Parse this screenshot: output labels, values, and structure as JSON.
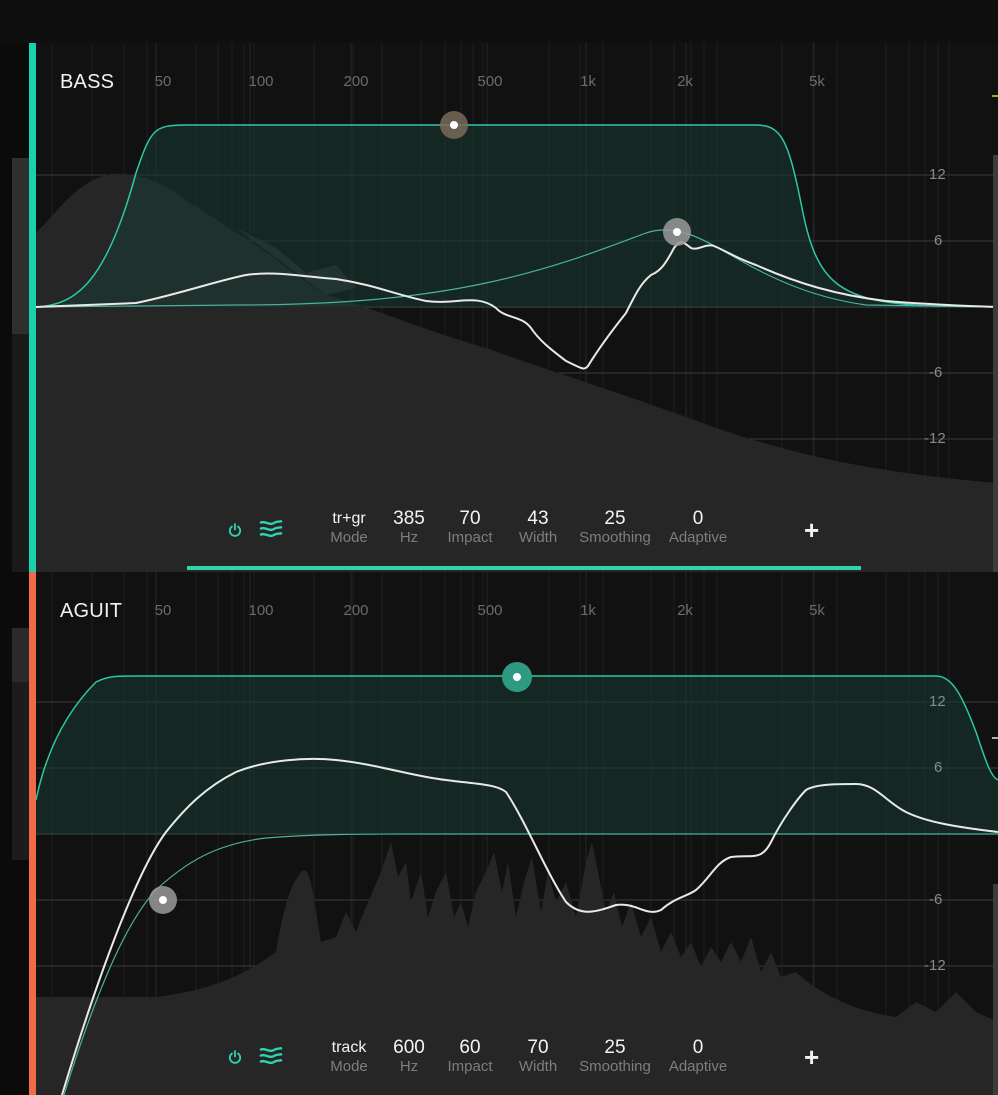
{
  "colors": {
    "accent_bass": "#19d2ad",
    "accent_aguit": "#f06a45",
    "curve": "#e9e9e9",
    "band": "#2ec7a6"
  },
  "freq_axis": [
    "50",
    "100",
    "200",
    "500",
    "1k",
    "2k",
    "5k"
  ],
  "db_axis": [
    "12",
    "6",
    "-6",
    "-12"
  ],
  "tracks": [
    {
      "name": "BASS",
      "mode": "tr+gr",
      "mode_label": "Mode",
      "hz": "385",
      "hz_label": "Hz",
      "impact": "70",
      "impact_label": "Impact",
      "width": "43",
      "width_label": "Width",
      "smoothing": "25",
      "smoothing_label": "Smoothing",
      "adaptive": "0",
      "adaptive_label": "Adaptive",
      "power_icon": "power-icon",
      "waves_icon": "waves-icon",
      "add_label": "+"
    },
    {
      "name": "AGUIT",
      "mode": "track",
      "mode_label": "Mode",
      "hz": "600",
      "hz_label": "Hz",
      "impact": "60",
      "impact_label": "Impact",
      "width": "70",
      "width_label": "Width",
      "smoothing": "25",
      "smoothing_label": "Smoothing",
      "adaptive": "0",
      "adaptive_label": "Adaptive",
      "power_icon": "power-icon",
      "waves_icon": "waves-icon",
      "add_label": "+"
    }
  ]
}
